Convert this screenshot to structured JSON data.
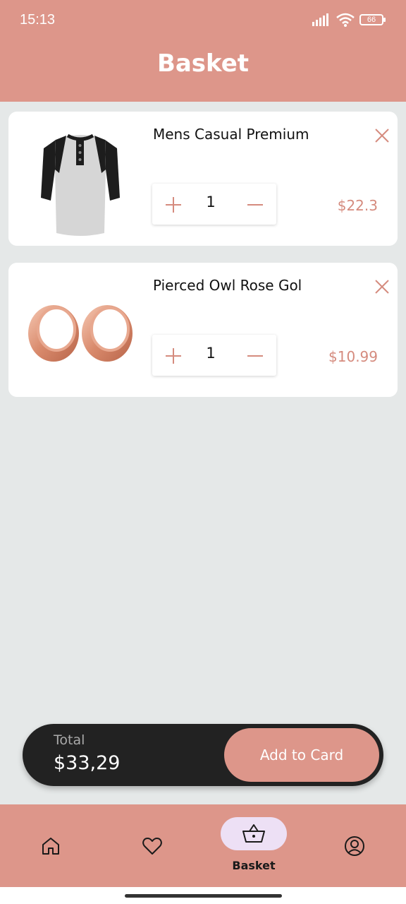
{
  "status_bar": {
    "time": "15:13",
    "battery": "66"
  },
  "header": {
    "title": "Basket"
  },
  "items": [
    {
      "name": "Mens Casual Premium",
      "quantity": "1",
      "price": "$22.3",
      "image_icon": "henley-shirt-image"
    },
    {
      "name": "Pierced Owl Rose Gol",
      "quantity": "1",
      "price": "$10.99",
      "image_icon": "rose-gold-ear-gauges-image"
    }
  ],
  "checkout": {
    "total_label": "Total",
    "total_value": "$33,29",
    "button_label": "Add to Card"
  },
  "bottom_nav": {
    "items": [
      {
        "icon": "home-icon"
      },
      {
        "icon": "heart-icon"
      },
      {
        "icon": "basket-icon",
        "label": "Basket",
        "active": true
      },
      {
        "icon": "profile-icon"
      }
    ]
  },
  "colors": {
    "accent": "#dd968a",
    "price": "#d58b7e",
    "background": "#e5e8e8",
    "checkout_bar": "#222222",
    "active_pill": "#ede0f5"
  }
}
